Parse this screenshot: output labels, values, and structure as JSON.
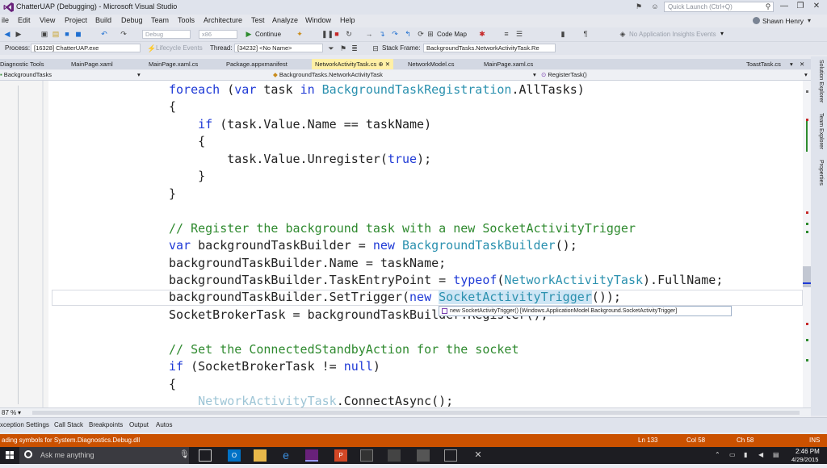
{
  "window": {
    "title": "ChatterUAP (Debugging) - Microsoft Visual Studio",
    "quick_launch_placeholder": "Quick Launch (Ctrl+Q)",
    "user": "Shawn Henry",
    "controls": [
      "—",
      "❐",
      "✕"
    ]
  },
  "menu": [
    "ile",
    "Edit",
    "View",
    "Project",
    "Build",
    "Debug",
    "Team",
    "Tools",
    "Architecture",
    "Test",
    "Analyze",
    "Window",
    "Help"
  ],
  "toolbar": {
    "config": "Debug",
    "platform": "x86",
    "continue_label": "Continue",
    "code_map_label": "Code Map",
    "insights_label": "No Application Insights Events"
  },
  "debug_toolbar": {
    "process_label": "Process:",
    "process_value": "[16328] ChatterUAP.exe",
    "lifecycle_label": "Lifecycle Events",
    "thread_label": "Thread:",
    "thread_value": "[34232] <No Name>",
    "stack_frame_label": "Stack Frame:",
    "stack_frame_value": "BackgroundTasks.NetworkActivityTask.Re"
  },
  "tabs": [
    {
      "label": "Diagnostic Tools"
    },
    {
      "label": "MainPage.xaml"
    },
    {
      "label": "MainPage.xaml.cs"
    },
    {
      "label": "Package.appxmanifest"
    },
    {
      "label": "NetworkActivityTask.cs ⊕ ✕",
      "active": true
    },
    {
      "label": "NetworkModel.cs"
    },
    {
      "label": "MainPage.xaml.cs"
    },
    {
      "label": "ToastTask.cs"
    }
  ],
  "navbar": {
    "project": "BackgroundTasks",
    "type": "BackgroundTasks.NetworkActivityTask",
    "member": "RegisterTask()"
  },
  "code_lines": [
    {
      "segments": [
        {
          "t": "foreach",
          "c": "kw"
        },
        {
          "t": " ("
        },
        {
          "t": "var",
          "c": "kw"
        },
        {
          "t": " task "
        },
        {
          "t": "in",
          "c": "kw"
        },
        {
          "t": " "
        },
        {
          "t": "BackgroundTaskRegistration",
          "c": "ty"
        },
        {
          "t": ".AllTasks)"
        }
      ]
    },
    {
      "segments": [
        {
          "t": "{"
        }
      ]
    },
    {
      "segments": [
        {
          "t": "    "
        },
        {
          "t": "if",
          "c": "kw"
        },
        {
          "t": " (task.Value.Name == taskName)"
        }
      ]
    },
    {
      "segments": [
        {
          "t": "    {"
        }
      ]
    },
    {
      "segments": [
        {
          "t": "        task.Value.Unregister("
        },
        {
          "t": "true",
          "c": "kw"
        },
        {
          "t": ");"
        }
      ]
    },
    {
      "segments": [
        {
          "t": "    }"
        }
      ]
    },
    {
      "segments": [
        {
          "t": "}"
        }
      ]
    },
    {
      "segments": [
        {
          "t": ""
        }
      ]
    },
    {
      "segments": [
        {
          "t": "// Register the background task with a new SocketActivityTrigger",
          "c": "cm"
        }
      ]
    },
    {
      "segments": [
        {
          "t": "var",
          "c": "kw"
        },
        {
          "t": " backgroundTaskBuilder = "
        },
        {
          "t": "new",
          "c": "kw"
        },
        {
          "t": " "
        },
        {
          "t": "BackgroundTaskBuilder",
          "c": "ty"
        },
        {
          "t": "();"
        }
      ]
    },
    {
      "segments": [
        {
          "t": "backgroundTaskBuilder.Name = taskName;"
        }
      ]
    },
    {
      "segments": [
        {
          "t": "backgroundTaskBuilder.TaskEntryPoint = "
        },
        {
          "t": "typeof",
          "c": "kw"
        },
        {
          "t": "("
        },
        {
          "t": "NetworkActivityTask",
          "c": "ty"
        },
        {
          "t": ").FullName;"
        }
      ]
    },
    {
      "segments": [
        {
          "t": "backgroundTaskBuilder.SetTrigger("
        },
        {
          "t": "new",
          "c": "kw"
        },
        {
          "t": " "
        },
        {
          "t": "SocketActivityTrigger",
          "c": "ty",
          "hover": true
        },
        {
          "t": "());"
        }
      ]
    },
    {
      "segments": [
        {
          "t": "SocketBrokerTask = backgroundTaskBuilder.Register();"
        }
      ]
    },
    {
      "segments": [
        {
          "t": ""
        }
      ]
    },
    {
      "segments": [
        {
          "t": "// Set the ConnectedStandbyAction for the socket",
          "c": "cm"
        }
      ]
    },
    {
      "segments": [
        {
          "t": "if",
          "c": "kw"
        },
        {
          "t": " (SocketBrokerTask != "
        },
        {
          "t": "null",
          "c": "kw"
        },
        {
          "t": ")"
        }
      ]
    },
    {
      "segments": [
        {
          "t": "{"
        }
      ]
    },
    {
      "segments": [
        {
          "t": "    "
        },
        {
          "t": "NetworkActivityTask",
          "c": "dim-ty"
        },
        {
          "t": ".ConnectAsync();"
        }
      ]
    }
  ],
  "tooltip": {
    "text": "new SocketActivityTrigger()   [Windows.ApplicationModel.Background.SocketActivityTrigger]"
  },
  "side_panel": [
    "Solution Explorer",
    "Team Explorer",
    "Properties"
  ],
  "zoom": "87 %",
  "bottom_tabs": [
    "xception Settings",
    "Call Stack",
    "Breakpoints",
    "Output",
    "Autos"
  ],
  "status": {
    "message": "ading symbols for System.Diagnostics.Debug.dll",
    "line": "Ln 133",
    "col": "Col 58",
    "ch": "Ch 58",
    "mode": "INS"
  },
  "taskbar": {
    "search_placeholder": "Ask me anything",
    "time": "2:46 PM",
    "date": "4/29/2015"
  },
  "colors": {
    "status_bar": "#ca5100",
    "keyword": "#1f3ad6",
    "type": "#2b91af",
    "comment": "#2f8a2f",
    "active_tab": "#fff0a6"
  }
}
